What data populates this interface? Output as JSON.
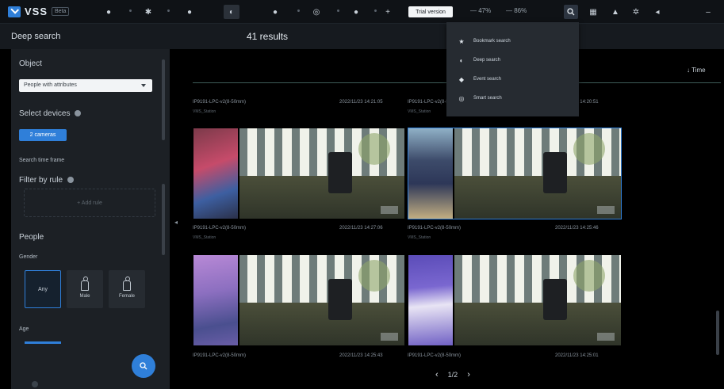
{
  "topbar": {
    "logo_text": "VSS",
    "logo_badge": "Beta",
    "trial_label": "Trial version",
    "cpu": "47%",
    "ram": "86%"
  },
  "subheader": {
    "title": "Deep search",
    "results": "41 results"
  },
  "left_panel": {
    "object_label": "Object",
    "object_value": "People with attributes",
    "select_devices_label": "Select devices",
    "devices_chip": "2 cameras",
    "search_time_label": "Search time frame",
    "filter_rule_label": "Filter by rule",
    "rule_placeholder": "+ Add rule",
    "people_label": "People",
    "gender_label": "Gender",
    "gender_options": [
      "Any",
      "Male",
      "Female"
    ],
    "age_label": "Age"
  },
  "content": {
    "sort_label": "Time",
    "cards": [
      {
        "camera": "IP9191-LPC-v2(8-50mm)",
        "time": "2022/11/23 14:21:05",
        "tag": "VMS_Station"
      },
      {
        "camera": "IP9191-LPC-v2(8-50mm)",
        "time": "2022/11/23 14:20:51",
        "tag": "VMS_Station"
      },
      {
        "camera": "IP9191-LPC-v2(8-50mm)",
        "time": "2022/11/23 14:27:06",
        "tag": "VMS_Station"
      },
      {
        "camera": "IP9191-LPC-v2(8-50mm)",
        "time": "2022/11/23 14:25:46",
        "tag": "VMS_Station"
      },
      {
        "camera": "IP9191-LPC-v2(8-50mm)",
        "time": "2022/11/23 14:25:43",
        "tag": ""
      },
      {
        "camera": "IP9191-LPC-v2(8-50mm)",
        "time": "2022/11/23 14:25:01",
        "tag": ""
      }
    ],
    "pager": "1/2"
  },
  "dropdown": {
    "items": [
      {
        "label": "Bookmark search",
        "icon": "star-icon"
      },
      {
        "label": "Deep search",
        "icon": "deep-search-icon"
      },
      {
        "label": "Event search",
        "icon": "event-icon"
      },
      {
        "label": "Smart search",
        "icon": "smart-search-icon"
      }
    ]
  },
  "colors": {
    "accent": "#2f7fd9",
    "panel": "#1c2025",
    "topbar": "#0f1216"
  }
}
